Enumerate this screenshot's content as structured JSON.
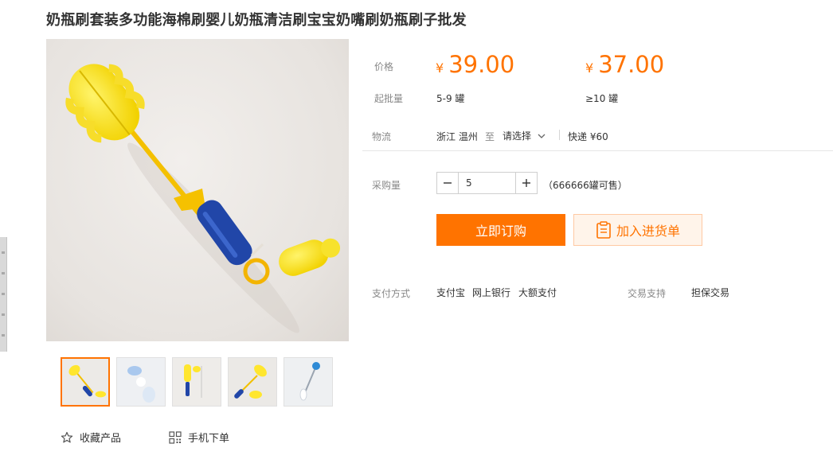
{
  "title": "奶瓶刷套装多功能海棉刷婴儿奶瓶清洁刷宝宝奶嘴刷奶瓶刷子批发",
  "colors": {
    "accent": "#ff7300",
    "price": "#ff7300",
    "cart_bg": "#fff4ea",
    "label": "#888888"
  },
  "price": {
    "label": "价格",
    "currency": "¥",
    "tiers": [
      {
        "price": "39.00",
        "quantity": "5-9 罐"
      },
      {
        "price": "37.00",
        "quantity": "≥10 罐"
      }
    ]
  },
  "moq": {
    "label": "起批量"
  },
  "logistics": {
    "label": "物流",
    "origin": "浙江 温州",
    "to": "至",
    "destination_placeholder": "请选择",
    "shipping": "快递 ¥60"
  },
  "purchase": {
    "label": "采购量",
    "quantity": "5",
    "stock": "（666666罐可售）"
  },
  "buttons": {
    "order": "立即订购",
    "cart": "加入进货单",
    "cart_icon": "clipboard-icon"
  },
  "payment": {
    "label": "支付方式",
    "methods": [
      "支付宝",
      "网上银行",
      "大额支付"
    ]
  },
  "trade": {
    "label": "交易支持",
    "value": "担保交易"
  },
  "gallery": {
    "thumbnail_count": 5,
    "active_index": 0
  },
  "actions": {
    "favorite": "收藏产品",
    "favorite_icon": "star-outline-icon",
    "mobile_order": "手机下单",
    "mobile_icon": "qr-code-icon"
  }
}
